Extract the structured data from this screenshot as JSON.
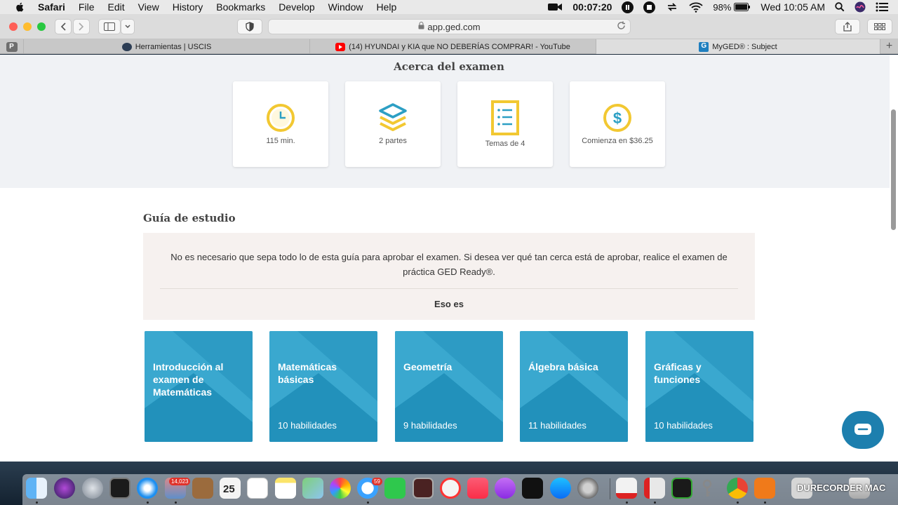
{
  "menubar": {
    "app": "Safari",
    "items": [
      "File",
      "Edit",
      "View",
      "History",
      "Bookmarks",
      "Develop",
      "Window",
      "Help"
    ],
    "record_time": "00:07:20",
    "battery": "98%",
    "clock": "Wed 10:05 AM"
  },
  "browser": {
    "url": "app.ged.com",
    "tabs": [
      {
        "label": "Herramientas | USCIS"
      },
      {
        "label": "(14) HYUNDAI y KIA que NO DEBERÍAS COMPRAR! - YouTube"
      },
      {
        "label": "MyGED® : Subject"
      }
    ],
    "pinned_tab_letter": "P"
  },
  "about": {
    "title": "Acerca del examen",
    "stats": [
      {
        "icon": "clock-icon",
        "label": "115 min."
      },
      {
        "icon": "layers-icon",
        "label": "2 partes"
      },
      {
        "icon": "list-icon",
        "label": "Temas de 4"
      },
      {
        "icon": "dollar-icon",
        "label": "Comienza en $36.25"
      }
    ]
  },
  "guide": {
    "title": "Guía de estudio",
    "note": "No es necesario que sepa todo lo de esta guía para aprobar el examen. Si desea ver qué tan cerca está de aprobar, realice el examen de práctica GED Ready®.",
    "eso_es": "Eso es",
    "cards": [
      {
        "title": "Introducción al examen de Matemáticas",
        "skills": ""
      },
      {
        "title": "Matemáticas básicas",
        "skills": "10 habilidades"
      },
      {
        "title": "Geometría",
        "skills": "9 habilidades"
      },
      {
        "title": "Álgebra básica",
        "skills": "11 habilidades"
      },
      {
        "title": "Gráficas y funciones",
        "skills": "10 habilidades"
      }
    ]
  },
  "dock": {
    "maps_badge": "14,023",
    "messages_badge": "59",
    "calendar_day": "25",
    "watermark": "DURECORDER MAC"
  },
  "colors": {
    "card_blue": "#2d9bc4",
    "icon_yellow": "#f2c832",
    "icon_teal": "#2c9fc4",
    "chat_blue": "#1d7fae"
  }
}
